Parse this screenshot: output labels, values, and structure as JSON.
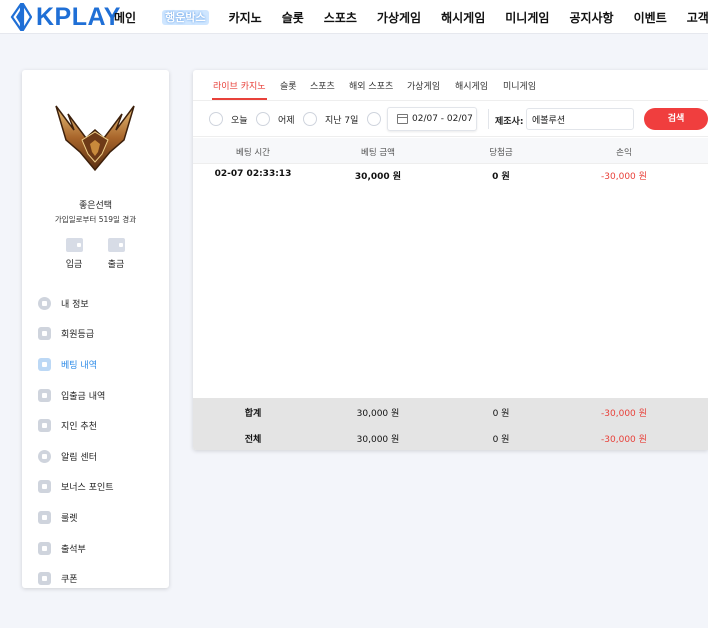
{
  "brand": {
    "name": "KPLAY"
  },
  "nav": {
    "items": [
      "메인",
      "행운박스",
      "카지노",
      "슬롯",
      "스포츠",
      "가상게임",
      "해시게임",
      "미니게임",
      "공지사항",
      "이벤트",
      "고객센"
    ]
  },
  "profile": {
    "username": "좋은선택",
    "joined_text": "가입일로부터 519일 경과",
    "deposit_label": "입금",
    "withdraw_label": "출금"
  },
  "menu": {
    "items": [
      {
        "label": "내 정보",
        "icon": "user-icon"
      },
      {
        "label": "회원등급",
        "icon": "grade-icon"
      },
      {
        "label": "베팅 내역",
        "icon": "bet-history-icon"
      },
      {
        "label": "입출금 내역",
        "icon": "wallet-icon"
      },
      {
        "label": "지인 추천",
        "icon": "heart-icon"
      },
      {
        "label": "알림 센터",
        "icon": "chat-icon"
      },
      {
        "label": "보너스 포인트",
        "icon": "point-icon"
      },
      {
        "label": "룰렛",
        "icon": "roulette-icon"
      },
      {
        "label": "출석부",
        "icon": "calendar-icon"
      },
      {
        "label": "쿠폰",
        "icon": "coupon-icon"
      }
    ],
    "active": "베팅 내역"
  },
  "tabs": [
    "라이브 카지노",
    "슬롯",
    "스포츠",
    "해외 스포츠",
    "가상게임",
    "해시게임",
    "미니게임"
  ],
  "filter": {
    "today": "오늘",
    "yesterday": "어제",
    "last7": "지난 7일",
    "date_range": "02/07 - 02/07",
    "maker_label": "제조사:",
    "maker_value": "에볼루션",
    "search_label": "검색"
  },
  "table": {
    "headers": [
      "베팅 시간",
      "베팅 금액",
      "당첨금",
      "손익"
    ],
    "rows": [
      {
        "time": "02-07 02:33:13",
        "amount": "30,000 원",
        "win": "0 원",
        "profit": "-30,000 원"
      }
    ],
    "summary": [
      {
        "label": "합계",
        "amount": "30,000 원",
        "win": "0 원",
        "profit": "-30,000 원"
      },
      {
        "label": "전체",
        "amount": "30,000 원",
        "win": "0 원",
        "profit": "-30,000 원"
      }
    ]
  },
  "colors": {
    "brand": "#1f6fd6",
    "accent": "#e8413a",
    "active_menu": "#2d8be8"
  }
}
